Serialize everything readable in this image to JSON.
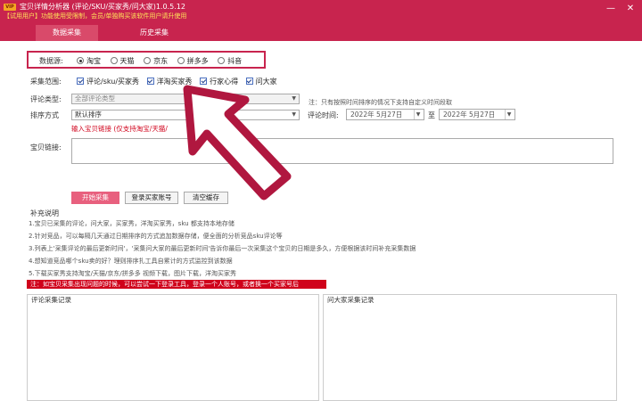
{
  "window": {
    "badge": "VIP",
    "title": "宝贝详情分析器 (评论/SKU/买家秀/问大家)1.0.5.12",
    "trial_notice": "【试用用户】功能使用受限制，会员/单独购买该软件用户请升使用",
    "minimize": "—",
    "close": "✕"
  },
  "tabs": [
    {
      "label": "数据采集"
    },
    {
      "label": "历史采集"
    }
  ],
  "source": {
    "label": "数据源:",
    "options": [
      "淘宝",
      "天猫",
      "京东",
      "拼多多",
      "抖音"
    ],
    "selected": "淘宝"
  },
  "scope": {
    "label": "采集范围:",
    "options": [
      {
        "label": "评论/sku/买家秀",
        "checked": true
      },
      {
        "label": "洋淘买家秀",
        "checked": true
      },
      {
        "label": "行家心得",
        "checked": true
      },
      {
        "label": "问大家",
        "checked": true
      }
    ]
  },
  "review_type": {
    "label": "评论类型:",
    "value": "全部评论类型"
  },
  "sort": {
    "label": "排序方式",
    "value": "默认排序",
    "note": "注：只有按照时间排序的情况下支持自定义时间段取"
  },
  "review_time": {
    "label": "评论时间:",
    "start": "2022年 5月27日",
    "separator": "至",
    "end": "2022年 5月27日"
  },
  "link": {
    "hint": "输入宝贝链接 (仅支持淘宝/天猫/",
    "label": "宝贝链接:"
  },
  "actions": {
    "start": "开始采集",
    "login": "登录买家账号",
    "clear": "清空缓存"
  },
  "notes": {
    "title": "补充说明",
    "lines": [
      "1.宝贝已采集的评论，问大家，买家秀，洋淘买家秀，sku 都支持本地存储",
      "2.针对竞品，可以每隔几天通过日期排序的方式追加数据存储，便全面的分析竞品sku评论等",
      "3.列表上'采集评论的最后更新时间'，'采集问大家的最后更新时间'告诉你最后一次采集这个宝贝的日期是多久，方便根据该时间补充采集数据",
      "4.想知道竞品哪个sku卖的好？理则排序扎工具自累计的方式监控到该数据",
      "5.下载买家秀支持淘宝/天猫/京东/拼多多 视频下载，图片下载，洋淘买家秀"
    ],
    "warning": "注：如宝贝采集出现问题的时候，可以尝试一下登录工具，登录一个人账号，或者换一个买家号后"
  },
  "panels": {
    "reviews": "评论采集记录",
    "qa": "问大家采集记录"
  },
  "colors": {
    "brand": "#c8244e",
    "accent_red": "#d0021b",
    "overlay_arrow": "#b0173f"
  }
}
